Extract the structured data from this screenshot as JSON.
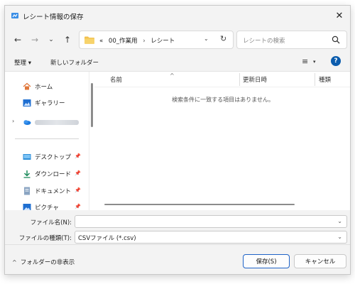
{
  "window": {
    "title": "レシート情報の保存",
    "close_glyph": "✕"
  },
  "nav": {
    "back_glyph": "←",
    "forward_glyph": "→",
    "recent_glyph": "⌄",
    "up_glyph": "↑",
    "breadcrumb_overflow": "«",
    "breadcrumb": [
      "00_作業用",
      "レシート"
    ],
    "breadcrumb_separator": "›",
    "dropdown_glyph": "⌄",
    "refresh_glyph": "↻",
    "search_placeholder": "レシートの検索"
  },
  "toolbar": {
    "organize": "整理 ▾",
    "new_folder": "新しいフォルダー",
    "view_glyph": "≡",
    "view_dropdown_glyph": "▾",
    "help_glyph": "?"
  },
  "sidebar": {
    "items": [
      {
        "label": "ホーム",
        "icon": "home-icon"
      },
      {
        "label": "ギャラリー",
        "icon": "gallery-icon"
      },
      {
        "label": "",
        "icon": "onedrive-icon",
        "expander": "›"
      },
      {
        "label": "デスクトップ",
        "icon": "desktop-icon",
        "pin": "📌"
      },
      {
        "label": "ダウンロード",
        "icon": "download-icon",
        "pin": "📌"
      },
      {
        "label": "ドキュメント",
        "icon": "document-icon",
        "pin": "📌"
      },
      {
        "label": "ピクチャ",
        "icon": "pictures-icon",
        "pin": "📌"
      }
    ]
  },
  "filelist": {
    "columns": [
      "名前",
      "更新日時",
      "種類"
    ],
    "sort_glyph": "^",
    "empty_message": "検索条件に一致する項目はありません。"
  },
  "form": {
    "filename_label": "ファイル名(N):",
    "filename_value": "",
    "filetype_label": "ファイルの種類(T):",
    "filetype_value": "CSVファイル (*.csv)",
    "dropdown_glyph": "⌄"
  },
  "footer": {
    "hide_folders": "フォルダーの非表示",
    "hide_chevron": "^",
    "save": "保存(S)",
    "cancel": "キャンセル"
  },
  "colors": {
    "accent": "#1f63c7",
    "folder": "#f2c14e",
    "help": "#0b5cad"
  }
}
